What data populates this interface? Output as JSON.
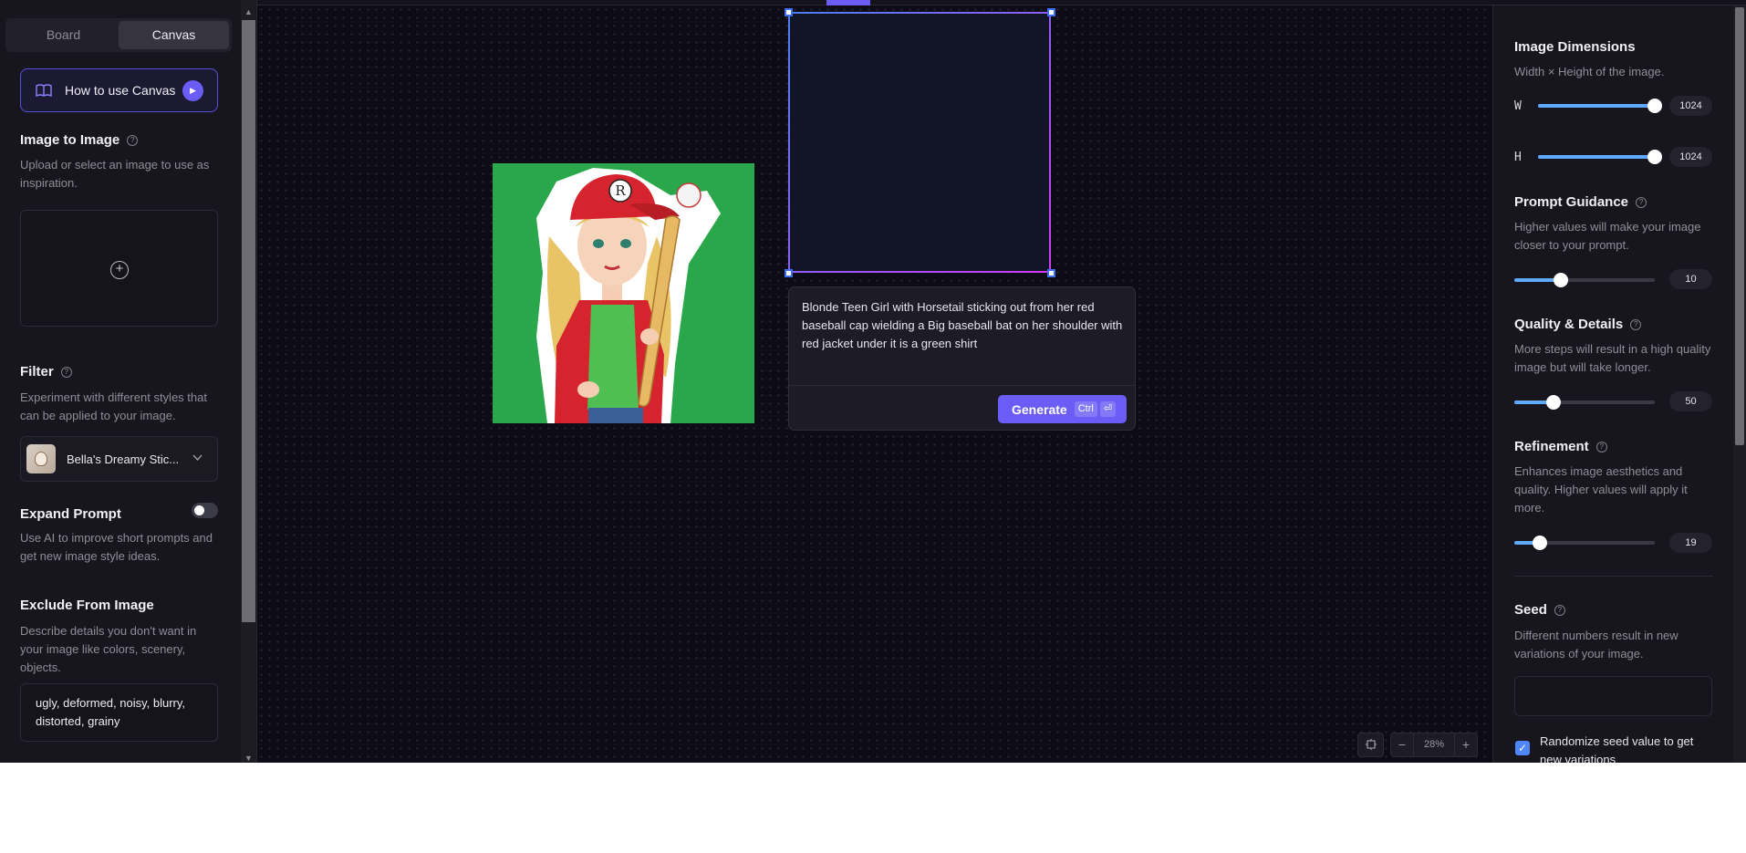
{
  "left_panel": {
    "tabs": [
      {
        "label": "Board",
        "active": false
      },
      {
        "label": "Canvas",
        "active": true
      }
    ],
    "how_to_button": "How to use Canvas",
    "image_to_image": {
      "title": "Image to Image",
      "description": "Upload or select an image to use as inspiration."
    },
    "filter": {
      "title": "Filter",
      "description": "Experiment with different styles that can be applied to your image.",
      "selected": "Bella's Dreamy Stic..."
    },
    "expand_prompt": {
      "title": "Expand Prompt",
      "description": "Use AI to improve short prompts and get new image style ideas.",
      "enabled": false
    },
    "exclude": {
      "title": "Exclude From Image",
      "description": "Describe details you don't want in your image like colors, scenery, objects.",
      "value": "ugly, deformed, noisy, blurry, distorted, grainy"
    }
  },
  "canvas": {
    "prompt": "Blonde Teen Girl with Horsetail sticking out from her red baseball cap wielding a Big baseball bat on her shoulder with red jacket under it is a green shirt",
    "generate_button": "Generate",
    "shortcut_key": "Ctrl",
    "shortcut_enter": "⏎",
    "zoom": {
      "value": "28%",
      "minus": "−",
      "plus": "+"
    },
    "image_letter": "R"
  },
  "right_panel": {
    "image_dimensions": {
      "title": "Image Dimensions",
      "description": "Width × Height of the image.",
      "width_label": "W",
      "height_label": "H",
      "width": "1024",
      "height": "1024",
      "width_fraction": 1.0,
      "height_fraction": 1.0
    },
    "prompt_guidance": {
      "title": "Prompt Guidance",
      "description": "Higher values will make your image closer to your prompt.",
      "value": "10",
      "fraction": 0.33
    },
    "quality_details": {
      "title": "Quality & Details",
      "description": "More steps will result in a high quality image but will take longer.",
      "value": "50",
      "fraction": 0.28
    },
    "refinement": {
      "title": "Refinement",
      "description": "Enhances image aesthetics and quality. Higher values will apply it more.",
      "value": "19",
      "fraction": 0.18
    },
    "seed": {
      "title": "Seed",
      "description": "Different numbers result in new variations of your image.",
      "value": "",
      "randomize_label": "Randomize seed value to get new variations",
      "randomize_checked": true
    }
  },
  "colors": {
    "accent": "#6a5cf5",
    "slider": "#5fa9ff",
    "background": "#0d0c16"
  }
}
